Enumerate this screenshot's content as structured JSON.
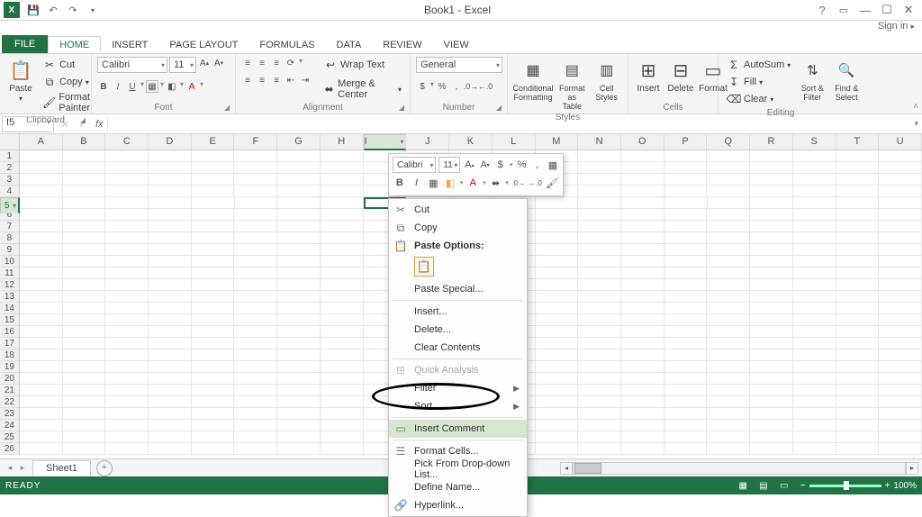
{
  "titlebar": {
    "title": "Book1 - Excel",
    "signin": "Sign in"
  },
  "tabs": [
    "FILE",
    "HOME",
    "INSERT",
    "PAGE LAYOUT",
    "FORMULAS",
    "DATA",
    "REVIEW",
    "VIEW"
  ],
  "active_tab": "HOME",
  "ribbon": {
    "clipboard": {
      "label": "Clipboard",
      "paste": "Paste",
      "cut": "Cut",
      "copy": "Copy",
      "format_painter": "Format Painter"
    },
    "font": {
      "label": "Font",
      "name": "Calibri",
      "size": "11"
    },
    "alignment": {
      "label": "Alignment",
      "wrap": "Wrap Text",
      "merge": "Merge & Center"
    },
    "number": {
      "label": "Number",
      "format": "General"
    },
    "styles": {
      "label": "Styles",
      "cond": "Conditional Formatting",
      "table": "Format as Table",
      "cell": "Cell Styles"
    },
    "cells": {
      "label": "Cells",
      "insert": "Insert",
      "delete": "Delete",
      "format": "Format"
    },
    "editing": {
      "label": "Editing",
      "autosum": "AutoSum",
      "fill": "Fill",
      "clear": "Clear",
      "sort": "Sort & Filter",
      "find": "Find & Select"
    }
  },
  "namebox": "I5",
  "columns": [
    "A",
    "B",
    "C",
    "D",
    "E",
    "F",
    "G",
    "H",
    "I",
    "J",
    "K",
    "L",
    "M",
    "N",
    "O",
    "P",
    "Q",
    "R",
    "S",
    "T",
    "U"
  ],
  "rows": [
    1,
    2,
    3,
    4,
    5,
    6,
    7,
    8,
    9,
    10,
    11,
    12,
    13,
    14,
    15,
    16,
    17,
    18,
    19,
    20,
    21,
    22,
    23,
    24,
    25,
    26
  ],
  "active_col": "I",
  "active_row": 5,
  "mini": {
    "font": "Calibri",
    "size": "11"
  },
  "context_menu": {
    "cut": "Cut",
    "copy": "Copy",
    "paste_options": "Paste Options:",
    "paste_special": "Paste Special...",
    "insert": "Insert...",
    "delete": "Delete...",
    "clear": "Clear Contents",
    "quick": "Quick Analysis",
    "filter": "Filter",
    "sort": "Sort",
    "insert_comment": "Insert Comment",
    "format_cells": "Format Cells...",
    "dropdown": "Pick From Drop-down List...",
    "define_name": "Define Name...",
    "hyperlink": "Hyperlink..."
  },
  "sheet": {
    "name": "Sheet1"
  },
  "status": {
    "ready": "READY",
    "zoom": "100%"
  }
}
